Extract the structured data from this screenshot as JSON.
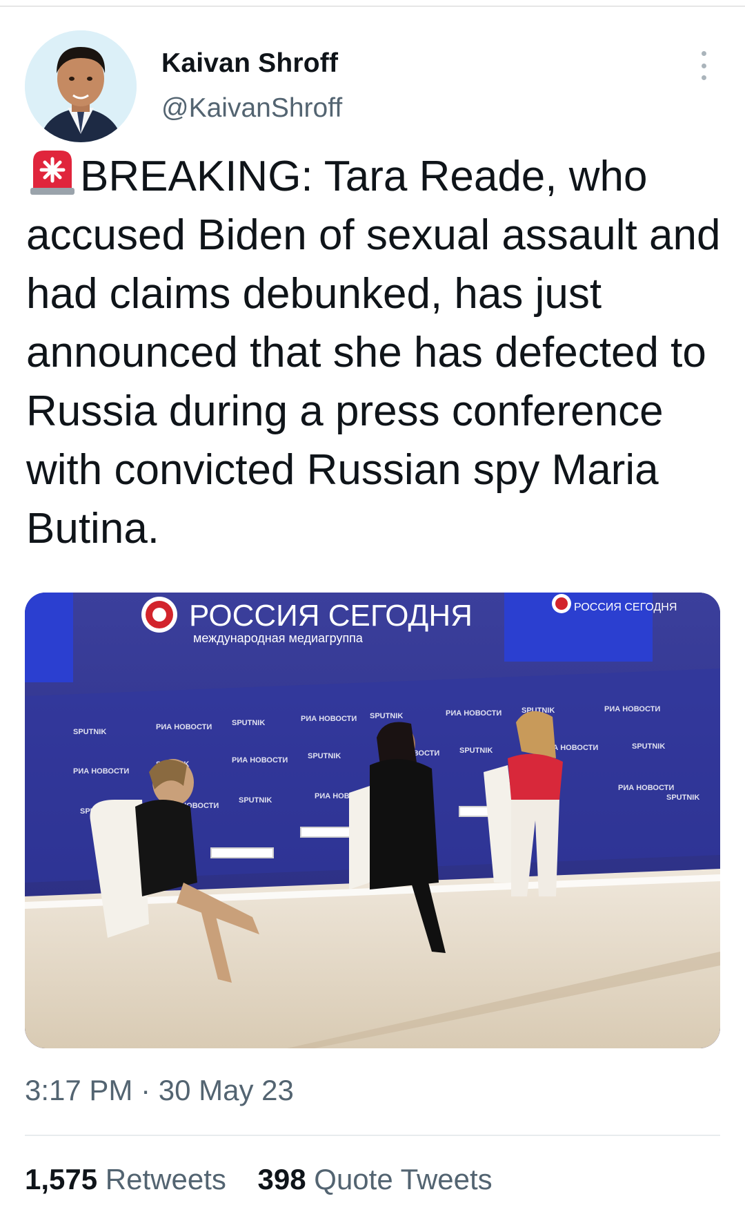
{
  "author": {
    "display_name": "Kaivan Shroff",
    "handle": "@KaivanShroff"
  },
  "tweet": {
    "text": "BREAKING: Tara Reade, who accused Biden of sexual assault and had claims debunked, has just announced that she has defected to Russia during a press conference with convicted Russian spy Maria Butina.",
    "leading_icon": "rotating-light-siren-icon",
    "timestamp": "3:17 PM · 30 May 23"
  },
  "media": {
    "backdrop_title": "РОССИЯ СЕГОДНЯ",
    "backdrop_subtitle": "международная медиагруппа",
    "screen_title": "РОССИЯ СЕГОДНЯ",
    "wall_logos": [
      "SPUTNIK",
      "РИА НОВОСТИ"
    ]
  },
  "stats": {
    "retweets_count": "1,575",
    "retweets_label": "Retweets",
    "quotes_count": "398",
    "quotes_label": "Quote Tweets"
  },
  "colors": {
    "text_primary": "#0f1419",
    "text_secondary": "#536471",
    "backdrop_blue": "#2f3590",
    "siren_red": "#e0253c"
  }
}
